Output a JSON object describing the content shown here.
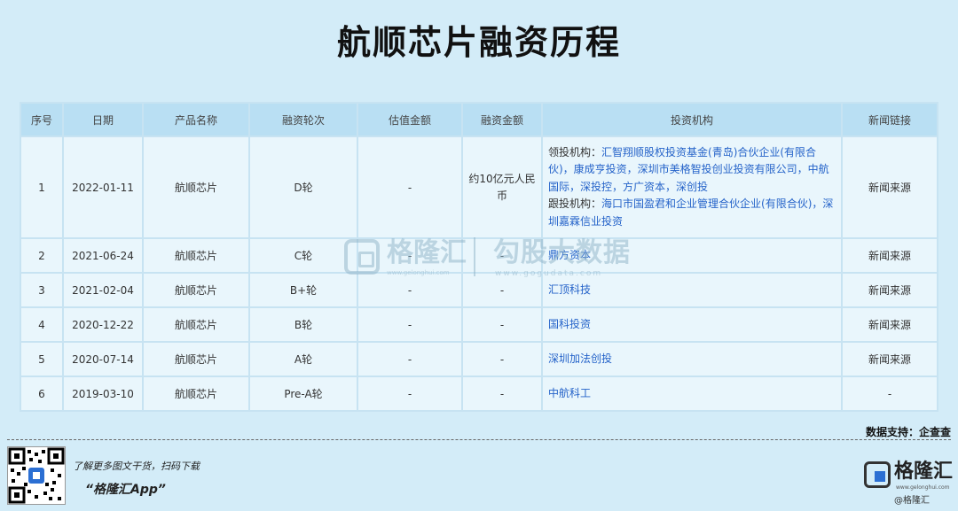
{
  "title": "航顺芯片融资历程",
  "table": {
    "headers": [
      "序号",
      "日期",
      "产品名称",
      "融资轮次",
      "估值金额",
      "融资金额",
      "投资机构",
      "新闻链接"
    ],
    "rows": [
      {
        "no": "1",
        "date": "2022-01-11",
        "product": "航顺芯片",
        "round": "D轮",
        "valuation": "-",
        "amount": "约10亿元人民币",
        "investors_lead_label": "领投机构：",
        "investors_lead": "汇智翔顺股权投资基金(青岛)合伙企业(有限合伙)，康成亨投资，深圳市美格智投创业投资有限公司，中航国际，深投控，方广资本，深创投",
        "investors_follow_label": "跟投机构：",
        "investors_follow": "海口市国盈君和企业管理合伙企业(有限合伙)，深圳嘉霖信业投资",
        "news": "新闻来源"
      },
      {
        "no": "2",
        "date": "2021-06-24",
        "product": "航顺芯片",
        "round": "C轮",
        "valuation": "-",
        "amount": "-",
        "investors": "鼎方资本",
        "news": "新闻来源"
      },
      {
        "no": "3",
        "date": "2021-02-04",
        "product": "航顺芯片",
        "round": "B+轮",
        "valuation": "-",
        "amount": "-",
        "investors": "汇顶科技",
        "news": "新闻来源"
      },
      {
        "no": "4",
        "date": "2020-12-22",
        "product": "航顺芯片",
        "round": "B轮",
        "valuation": "-",
        "amount": "-",
        "investors": "国科投资",
        "news": "新闻来源"
      },
      {
        "no": "5",
        "date": "2020-07-14",
        "product": "航顺芯片",
        "round": "A轮",
        "valuation": "-",
        "amount": "-",
        "investors": "深圳加法创投",
        "news": "新闻来源"
      },
      {
        "no": "6",
        "date": "2019-03-10",
        "product": "航顺芯片",
        "round": "Pre-A轮",
        "valuation": "-",
        "amount": "-",
        "investors": "中航科工",
        "news": "-"
      }
    ]
  },
  "watermark": {
    "brand": "格隆汇",
    "brand_url": "www.gelonghui.com",
    "name": "勾股大数据",
    "url": "www.gogudata.com"
  },
  "source": "数据支持：企查查",
  "footer": {
    "promo_line1": "了解更多图文干货，扫码下载",
    "promo_line2": "“格隆汇App”",
    "brand_name": "格隆汇",
    "brand_url": "www.gelonghui.com",
    "stamp": "@格隆汇"
  },
  "colors": {
    "background": "#d3ecf8",
    "header_bg": "#b9dff3",
    "row_bg": "#e9f6fc",
    "link": "#2563c9"
  }
}
